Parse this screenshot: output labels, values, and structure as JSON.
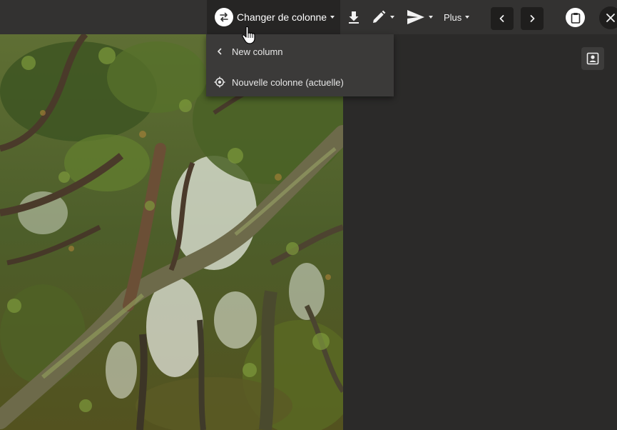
{
  "toolbar": {
    "change_column": {
      "label": "Changer de colonne",
      "icon": "swap-arrows-icon"
    },
    "download": {
      "icon": "download-icon"
    },
    "edit": {
      "icon": "pencil-icon"
    },
    "send": {
      "icon": "send-icon"
    },
    "more": {
      "label": "Plus"
    },
    "prev": {
      "icon": "chevron-left-icon"
    },
    "next": {
      "icon": "chevron-right-icon"
    },
    "clipboard": {
      "icon": "clipboard-icon"
    },
    "close": {
      "icon": "close-icon"
    }
  },
  "dropdown": {
    "items": [
      {
        "label": "New column",
        "icon": "chevron-left-icon"
      },
      {
        "label": "Nouvelle colonne (actuelle)",
        "icon": "crosshair-icon"
      }
    ]
  },
  "side_panel": {
    "contact_icon": "contact-card-icon"
  },
  "colors": {
    "toolbar_bg": "#333231",
    "active_bg": "#262524",
    "panel_bg": "#2b2a29",
    "menu_bg": "#3b3a39"
  }
}
